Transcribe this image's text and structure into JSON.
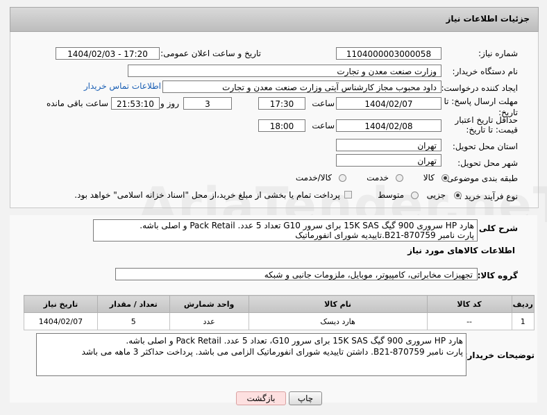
{
  "header": {
    "title": "جزئیات اطلاعات نیاز"
  },
  "form": {
    "need_number_label": "شماره نیاز:",
    "need_number": "1104000003000058",
    "announce_label": "تاریخ و ساعت اعلان عمومی:",
    "announce_value": "1404/02/03 - 17:20",
    "buyer_label": "نام دستگاه خریدار:",
    "buyer_value": "وزارت صنعت معدن و تجارت",
    "creator_label": "ایجاد کننده درخواست:",
    "creator_value": "داود محبوب مجاز کارشناس آیتی وزارت صنعت معدن و تجارت",
    "contact_link": "اطلاعات تماس خریدار",
    "deadline_label": "مهلت ارسال پاسخ: تا تاریخ:",
    "deadline_date": "1404/02/07",
    "time_label": "ساعت",
    "deadline_time": "17:30",
    "days_value": "3",
    "days_label": "روز و",
    "remaining_time": "21:53:10",
    "remaining_label": "ساعت باقی مانده",
    "price_valid_label": "حداقل تاریخ اعتبار قیمت: تا تاریخ:",
    "price_valid_date": "1404/02/08",
    "price_valid_time": "18:00",
    "province_label": "استان محل تحویل:",
    "province_value": "تهران",
    "city_label": "شهر محل تحویل:",
    "city_value": "تهران",
    "category_label": "طبقه بندی موضوعی:",
    "category_options": [
      "کالا",
      "خدمت",
      "کالا/خدمت"
    ],
    "process_label": "نوع فرآیند خرید :",
    "process_options": [
      "جزیی",
      "متوسط"
    ],
    "payment_note": "پرداخت تمام یا بخشی از مبلغ خرید،از محل \"اسناد خزانه اسلامی\" خواهد بود."
  },
  "summary": {
    "label": "شرح کلی نیاز:",
    "line1": "هارد HP سروری 900 گیگ 15K SAS برای سرور G10 تعداد 5 عدد. Pack Retail و اصلی باشه.",
    "line2": "پارت نامبر B21-870759.تاییدیه شورای انفورماتیک"
  },
  "goods": {
    "section_title": "اطلاعات کالاهای مورد نیاز",
    "group_label": "گروه کالا:",
    "group_value": "تجهیزات مخابراتی، کامپیوتر، موبایل، ملزومات جانبی و شبکه",
    "columns": [
      "ردیف",
      "کد کالا",
      "نام کالا",
      "واحد شمارش",
      "تعداد / مقدار",
      "تاریخ نیاز"
    ],
    "rows": [
      {
        "row": "1",
        "code": "--",
        "name": "هارد دیسک",
        "unit": "عدد",
        "qty": "5",
        "date": "1404/02/07"
      }
    ]
  },
  "buyer_notes": {
    "label": "توضیحات خریدار:",
    "line1": "هارد HP سروری 900 گیگ 15K SAS برای سرور G10، تعداد 5 عدد. Pack Retail و اصلی باشه.",
    "line2": "پارت نامبر B21-870759. داشتن تاییدیه شورای انفورماتیک الزامی می باشد. پرداخت حداکثر 3 ماهه می باشد"
  },
  "buttons": {
    "print": "چاپ",
    "back": "بازگشت"
  },
  "watermark": "AriaTender.neT"
}
